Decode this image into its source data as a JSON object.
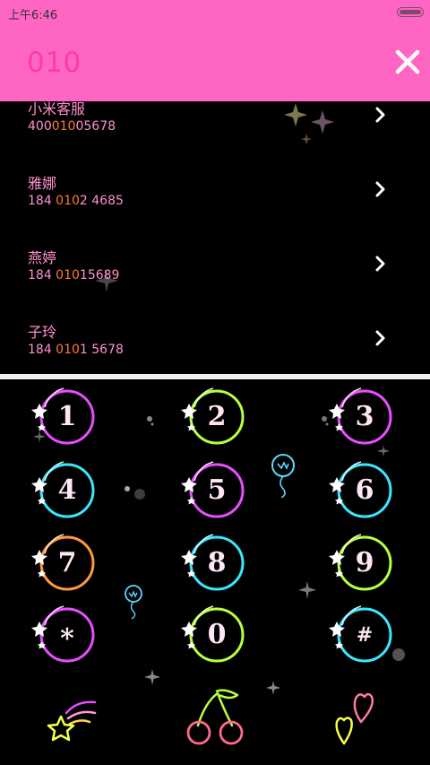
{
  "status_bar": {
    "time": "上午6:46"
  },
  "search": {
    "query": "010"
  },
  "contacts": [
    {
      "name": "小米客服",
      "number_parts": [
        "400",
        "010",
        "05678"
      ]
    },
    {
      "name": "雅娜",
      "number_parts": [
        "184 ",
        "010",
        "2 4685"
      ]
    },
    {
      "name": "燕婷",
      "number_parts": [
        "184 ",
        "010",
        "15689"
      ]
    },
    {
      "name": "子玲",
      "number_parts": [
        "184 ",
        "010",
        "1 5678"
      ]
    }
  ],
  "keypad": {
    "keys": [
      "1",
      "2",
      "3",
      "4",
      "5",
      "6",
      "7",
      "8",
      "9",
      "*",
      "0",
      "#"
    ]
  },
  "bottom_bar": {
    "left_icon": "shooting-star-icon",
    "center_icon": "cherry-icon",
    "right_icon": "hearts-icon"
  },
  "colors": {
    "header_bg": "#ff66c4",
    "query_text": "#ff3aa6",
    "list_text": "#ff8fd0",
    "match_highlight": "#ff7a26",
    "ring_colors": [
      "#e84dff",
      "#b8ff3d",
      "#e84dff",
      "#38e8ff",
      "#e84dff",
      "#38e8ff",
      "#ff9a3d",
      "#38e8ff",
      "#b8ff3d",
      "#e84dff",
      "#b8ff3d",
      "#38e8ff"
    ]
  }
}
